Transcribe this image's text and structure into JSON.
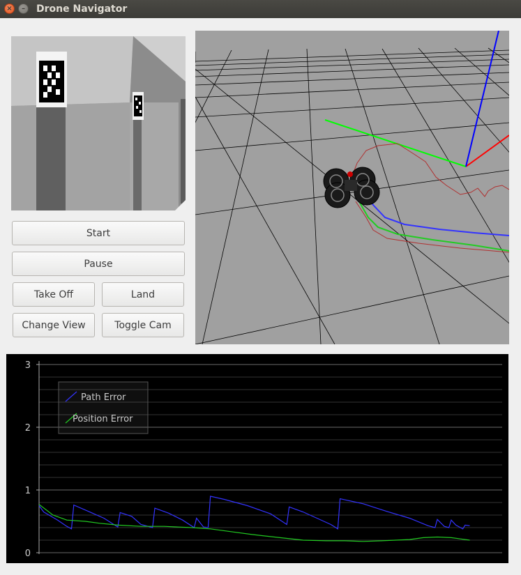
{
  "window": {
    "title": "Drone Navigator",
    "close_glyph": "×",
    "minimize_glyph": "–"
  },
  "controls": {
    "start": "Start",
    "pause": "Pause",
    "take_off": "Take Off",
    "land": "Land",
    "change_view": "Change View",
    "toggle_cam": "Toggle Cam"
  },
  "colors": {
    "path_error": "#3333ff",
    "position_error": "#22cc22",
    "axis_x": "#ff0000",
    "axis_y": "#00ff00",
    "axis_z": "#0000ff",
    "trajectory": "#b03030"
  },
  "chart_data": {
    "type": "line",
    "ylim": [
      0,
      3
    ],
    "yticks": [
      "0",
      "1",
      "2",
      "3"
    ],
    "grid": true,
    "legend": {
      "placement": "top-left",
      "entries": [
        "Path Error",
        "Position Error"
      ]
    },
    "series": [
      {
        "name": "Path Error",
        "points": [
          [
            0.0,
            0.75
          ],
          [
            0.01,
            0.65
          ],
          [
            0.04,
            0.52
          ],
          [
            0.06,
            0.42
          ],
          [
            0.07,
            0.38
          ],
          [
            0.075,
            0.76
          ],
          [
            0.1,
            0.68
          ],
          [
            0.14,
            0.55
          ],
          [
            0.17,
            0.41
          ],
          [
            0.175,
            0.64
          ],
          [
            0.2,
            0.58
          ],
          [
            0.22,
            0.45
          ],
          [
            0.245,
            0.4
          ],
          [
            0.25,
            0.71
          ],
          [
            0.28,
            0.63
          ],
          [
            0.31,
            0.52
          ],
          [
            0.335,
            0.4
          ],
          [
            0.34,
            0.55
          ],
          [
            0.355,
            0.41
          ],
          [
            0.365,
            0.4
          ],
          [
            0.37,
            0.9
          ],
          [
            0.4,
            0.85
          ],
          [
            0.45,
            0.75
          ],
          [
            0.5,
            0.62
          ],
          [
            0.535,
            0.45
          ],
          [
            0.54,
            0.73
          ],
          [
            0.57,
            0.65
          ],
          [
            0.6,
            0.55
          ],
          [
            0.63,
            0.45
          ],
          [
            0.645,
            0.38
          ],
          [
            0.65,
            0.86
          ],
          [
            0.7,
            0.78
          ],
          [
            0.75,
            0.66
          ],
          [
            0.8,
            0.55
          ],
          [
            0.84,
            0.43
          ],
          [
            0.855,
            0.4
          ],
          [
            0.86,
            0.53
          ],
          [
            0.875,
            0.42
          ],
          [
            0.885,
            0.4
          ],
          [
            0.89,
            0.52
          ],
          [
            0.9,
            0.44
          ],
          [
            0.915,
            0.38
          ],
          [
            0.92,
            0.44
          ],
          [
            0.93,
            0.43
          ]
        ]
      },
      {
        "name": "Position Error",
        "points": [
          [
            0.0,
            0.77
          ],
          [
            0.03,
            0.6
          ],
          [
            0.06,
            0.52
          ],
          [
            0.1,
            0.5
          ],
          [
            0.13,
            0.47
          ],
          [
            0.17,
            0.44
          ],
          [
            0.22,
            0.42
          ],
          [
            0.27,
            0.42
          ],
          [
            0.33,
            0.4
          ],
          [
            0.37,
            0.38
          ],
          [
            0.42,
            0.33
          ],
          [
            0.46,
            0.29
          ],
          [
            0.52,
            0.24
          ],
          [
            0.57,
            0.2
          ],
          [
            0.62,
            0.19
          ],
          [
            0.66,
            0.19
          ],
          [
            0.7,
            0.18
          ],
          [
            0.74,
            0.19
          ],
          [
            0.77,
            0.2
          ],
          [
            0.8,
            0.21
          ],
          [
            0.83,
            0.24
          ],
          [
            0.86,
            0.25
          ],
          [
            0.89,
            0.24
          ],
          [
            0.91,
            0.22
          ],
          [
            0.93,
            0.2
          ]
        ]
      }
    ]
  }
}
